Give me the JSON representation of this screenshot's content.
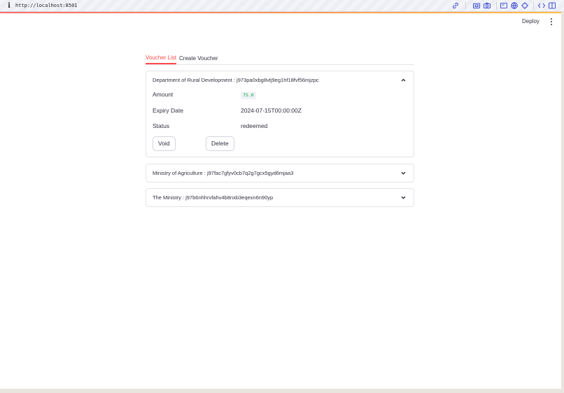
{
  "browser": {
    "url": "http://localhost:8501",
    "info_glyph": "i",
    "toolbar_icons": [
      "link-icon",
      "screenshot-icon",
      "camera-icon",
      "window-icon",
      "globe-icon",
      "crosshair-icon",
      "code-icon",
      "split-view-icon"
    ]
  },
  "app": {
    "deploy_label": "Deploy",
    "accent_colors": [
      "#ff6b6b",
      "#ffbd45"
    ],
    "active_tab_color": "#ff4b4b"
  },
  "tabs": [
    {
      "label": "Voucher List",
      "active": true
    },
    {
      "label": "Create Voucher",
      "active": false
    }
  ],
  "vouchers": [
    {
      "title": "Department of Rural Development : j973pa0xbg8vtj9eg1hf18fvf56mjzpc",
      "expanded": true,
      "fields": {
        "amount_label": "Amount",
        "amount_value": "75.0",
        "expiry_label": "Expiry Date",
        "expiry_value": "2024-07-15T00:00:00Z",
        "status_label": "Status",
        "status_value": "redeemed"
      },
      "void_label": "Void",
      "delete_label": "Delete"
    },
    {
      "title": "Ministry of Agriculture : j97fac7gfyv0cb7q2g7gcx5gyd6mjaa3",
      "expanded": false
    },
    {
      "title": "The Ministry : j97b6nhhrvfahv4b8nxb3eqexn6n90yp",
      "expanded": false
    }
  ]
}
